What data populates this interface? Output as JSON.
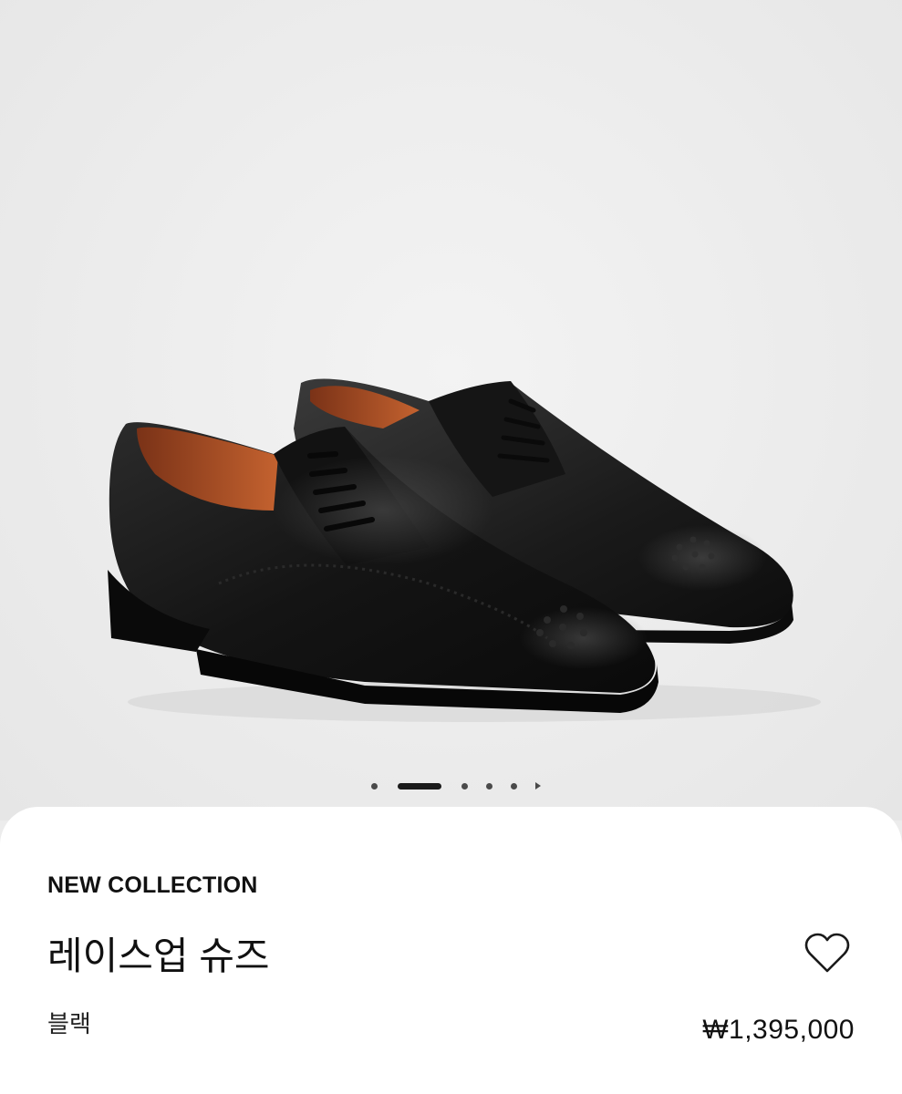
{
  "gallery": {
    "image_alt": "black brogue lace-up shoes",
    "slide_count": 6,
    "active_slide": 2
  },
  "product": {
    "collection": "NEW COLLECTION",
    "name": "레이스업 슈즈",
    "color": "블랙",
    "price": "₩1,395,000"
  },
  "icons": {
    "wishlist": "heart-icon",
    "pager_next": "chevron-right-icon"
  },
  "colors": {
    "background": "#ececec",
    "panel": "#ffffff",
    "text": "#111111",
    "shoe": "#1b1b1b",
    "lining": "#b5522b"
  }
}
